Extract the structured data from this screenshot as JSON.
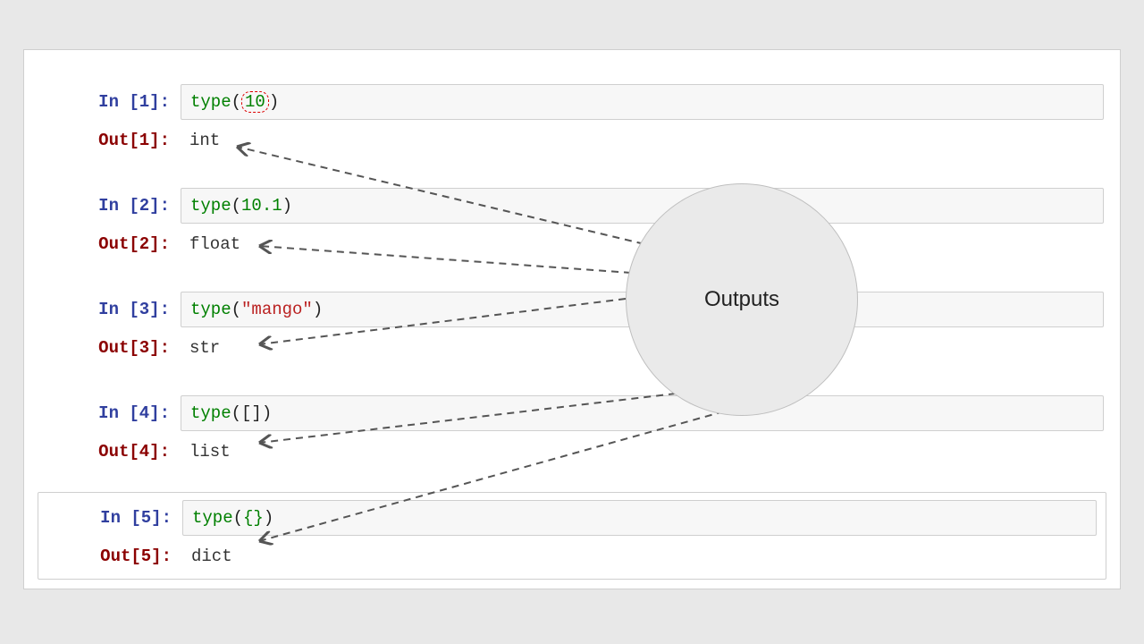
{
  "annotation": {
    "label": "Outputs"
  },
  "cells": [
    {
      "in_prompt": "In [1]:",
      "out_prompt": "Out[1]:",
      "input": {
        "func": "type",
        "open": "(",
        "arg": "10",
        "arg_class": "tok-number",
        "close": ")",
        "circled": true
      },
      "output": "int"
    },
    {
      "in_prompt": "In [2]:",
      "out_prompt": "Out[2]:",
      "input": {
        "func": "type",
        "open": "(",
        "arg": "10.1",
        "arg_class": "tok-number",
        "close": ")"
      },
      "output": "float"
    },
    {
      "in_prompt": "In [3]:",
      "out_prompt": "Out[3]:",
      "input": {
        "func": "type",
        "open": "(",
        "arg": "\"mango\"",
        "arg_class": "tok-string",
        "close": ")"
      },
      "output": "str"
    },
    {
      "in_prompt": "In [4]:",
      "out_prompt": "Out[4]:",
      "input": {
        "func": "type",
        "open": "(",
        "arg": "[]",
        "arg_class": "tok-paren",
        "close": ")"
      },
      "output": "list"
    },
    {
      "in_prompt": "In [5]:",
      "out_prompt": "Out[5]:",
      "input": {
        "func": "type",
        "open": "(",
        "arg": "{}",
        "arg_class": "tok-number",
        "close": ")"
      },
      "output": "dict",
      "selected": true
    }
  ]
}
